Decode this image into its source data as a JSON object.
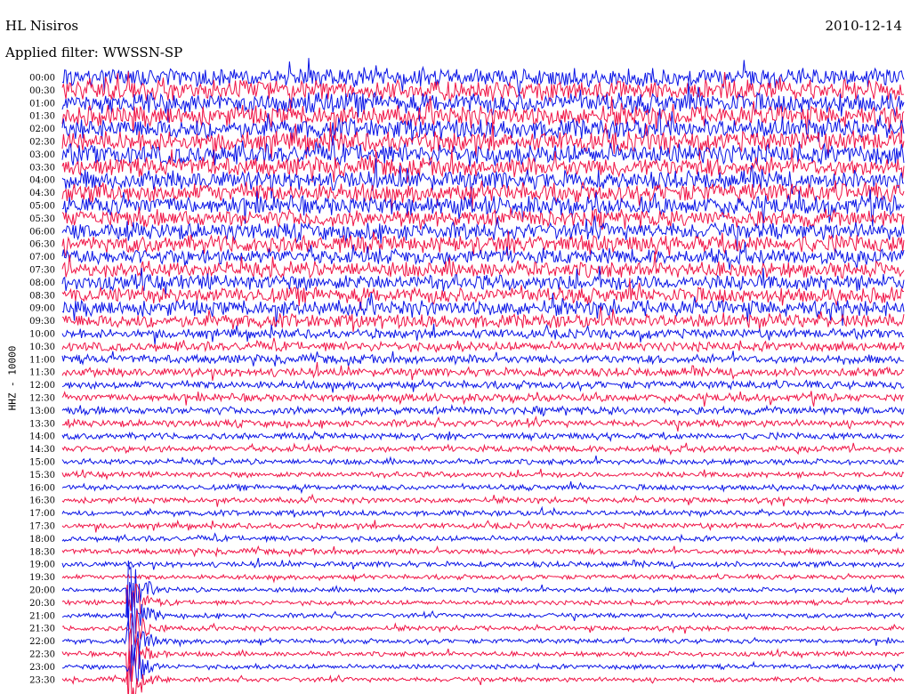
{
  "header": {
    "station": "HL Nisiros",
    "date": "2010-12-14",
    "filter": "Applied filter: WWSSN-SP"
  },
  "axis": {
    "ylabel": "HHZ - 10000"
  },
  "colors": {
    "trace_a": "#0a14e6",
    "trace_b": "#f01446",
    "background": "#ffffff"
  },
  "chart_data": {
    "type": "line",
    "title": "HL Nisiros",
    "subtitle": "Applied filter: WWSSN-SP",
    "ylabel": "HHZ - 10000",
    "xlabel": "",
    "row_labels": [
      "00:00",
      "00:30",
      "01:00",
      "01:30",
      "02:00",
      "02:30",
      "03:00",
      "03:30",
      "04:00",
      "04:30",
      "05:00",
      "05:30",
      "06:00",
      "06:30",
      "07:00",
      "07:30",
      "08:00",
      "08:30",
      "09:00",
      "09:30",
      "10:00",
      "10:30",
      "11:00",
      "11:30",
      "12:00",
      "12:30",
      "13:00",
      "13:30",
      "14:00",
      "14:30",
      "15:00",
      "15:30",
      "16:00",
      "16:30",
      "17:00",
      "17:30",
      "18:00",
      "18:30",
      "19:00",
      "19:30",
      "20:00",
      "20:30",
      "21:00",
      "21:30",
      "22:00",
      "22:30",
      "23:00",
      "23:30"
    ],
    "series": [
      {
        "color": "#0a14e6",
        "rows": "even"
      },
      {
        "color": "#f01446",
        "rows": "odd"
      }
    ],
    "noise_level": [
      12,
      13,
      13,
      13,
      13,
      13,
      13,
      12,
      12,
      12,
      12,
      11,
      11,
      11,
      10,
      10,
      10,
      10,
      10,
      9,
      6,
      6,
      5.5,
      5.5,
      5,
      5,
      5,
      4.5,
      4,
      4,
      3.5,
      3.5,
      3.5,
      3.5,
      3.5,
      3.5,
      3.5,
      3.5,
      3.5,
      3,
      3,
      3,
      3,
      3,
      3,
      3,
      3,
      3
    ],
    "event": {
      "start_row": 40,
      "end_row": 47,
      "time_within_row_fraction": 0.08,
      "peak_amplitude": 40
    },
    "grid": false
  }
}
